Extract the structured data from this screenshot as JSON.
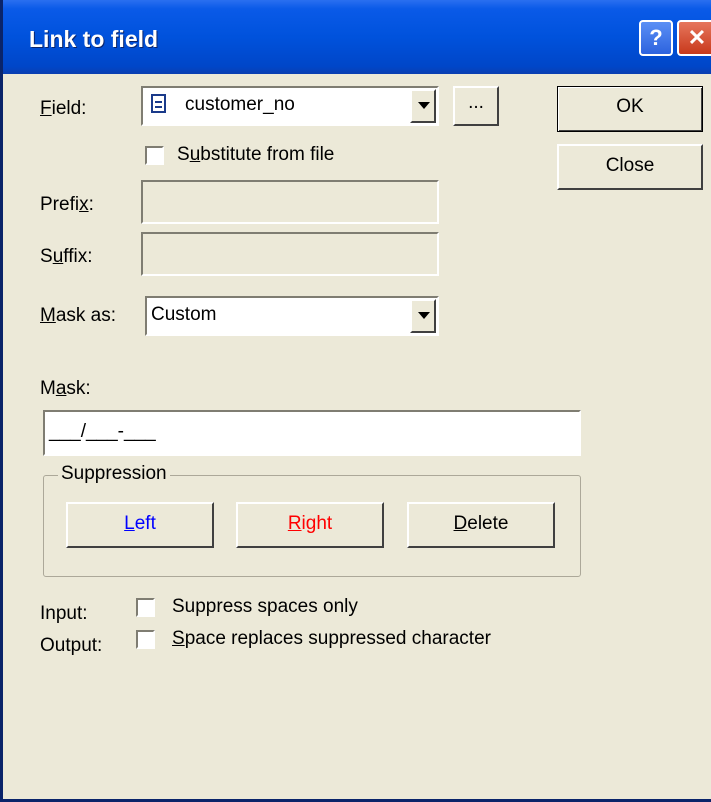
{
  "window": {
    "title": "Link to field",
    "help_glyph": "?",
    "close_glyph": "✕"
  },
  "field": {
    "label_accel": "F",
    "label_rest": "ield:",
    "value": "customer_no",
    "icon": "document-icon",
    "browse_label": "..."
  },
  "substitute": {
    "pre": "S",
    "accel": "u",
    "rest": "bstitute from file",
    "checked": false
  },
  "prefix": {
    "pre": "Prefi",
    "accel": "x",
    "rest": ":"
  },
  "suffix": {
    "pre": "S",
    "accel": "u",
    "rest": "ffix:"
  },
  "mask_as": {
    "accel": "M",
    "rest": "ask as:",
    "value": "Custom"
  },
  "mask": {
    "pre": "M",
    "accel": "a",
    "rest": "sk:",
    "value": "___/___-___"
  },
  "suppression": {
    "title": "Suppression",
    "left": {
      "accel": "L",
      "rest": "eft",
      "color": "#0000ff"
    },
    "right": {
      "accel": "R",
      "rest": "ight",
      "color": "#ff0000"
    },
    "delete": {
      "accel": "D",
      "rest": "elete"
    }
  },
  "input": {
    "label": "Input:",
    "option": "Suppress spaces only",
    "checked": false
  },
  "output": {
    "label": "Output:",
    "option_accel": "S",
    "option_rest": "pace replaces suppressed character",
    "checked": false
  },
  "buttons": {
    "ok": "OK",
    "close": "Close"
  }
}
